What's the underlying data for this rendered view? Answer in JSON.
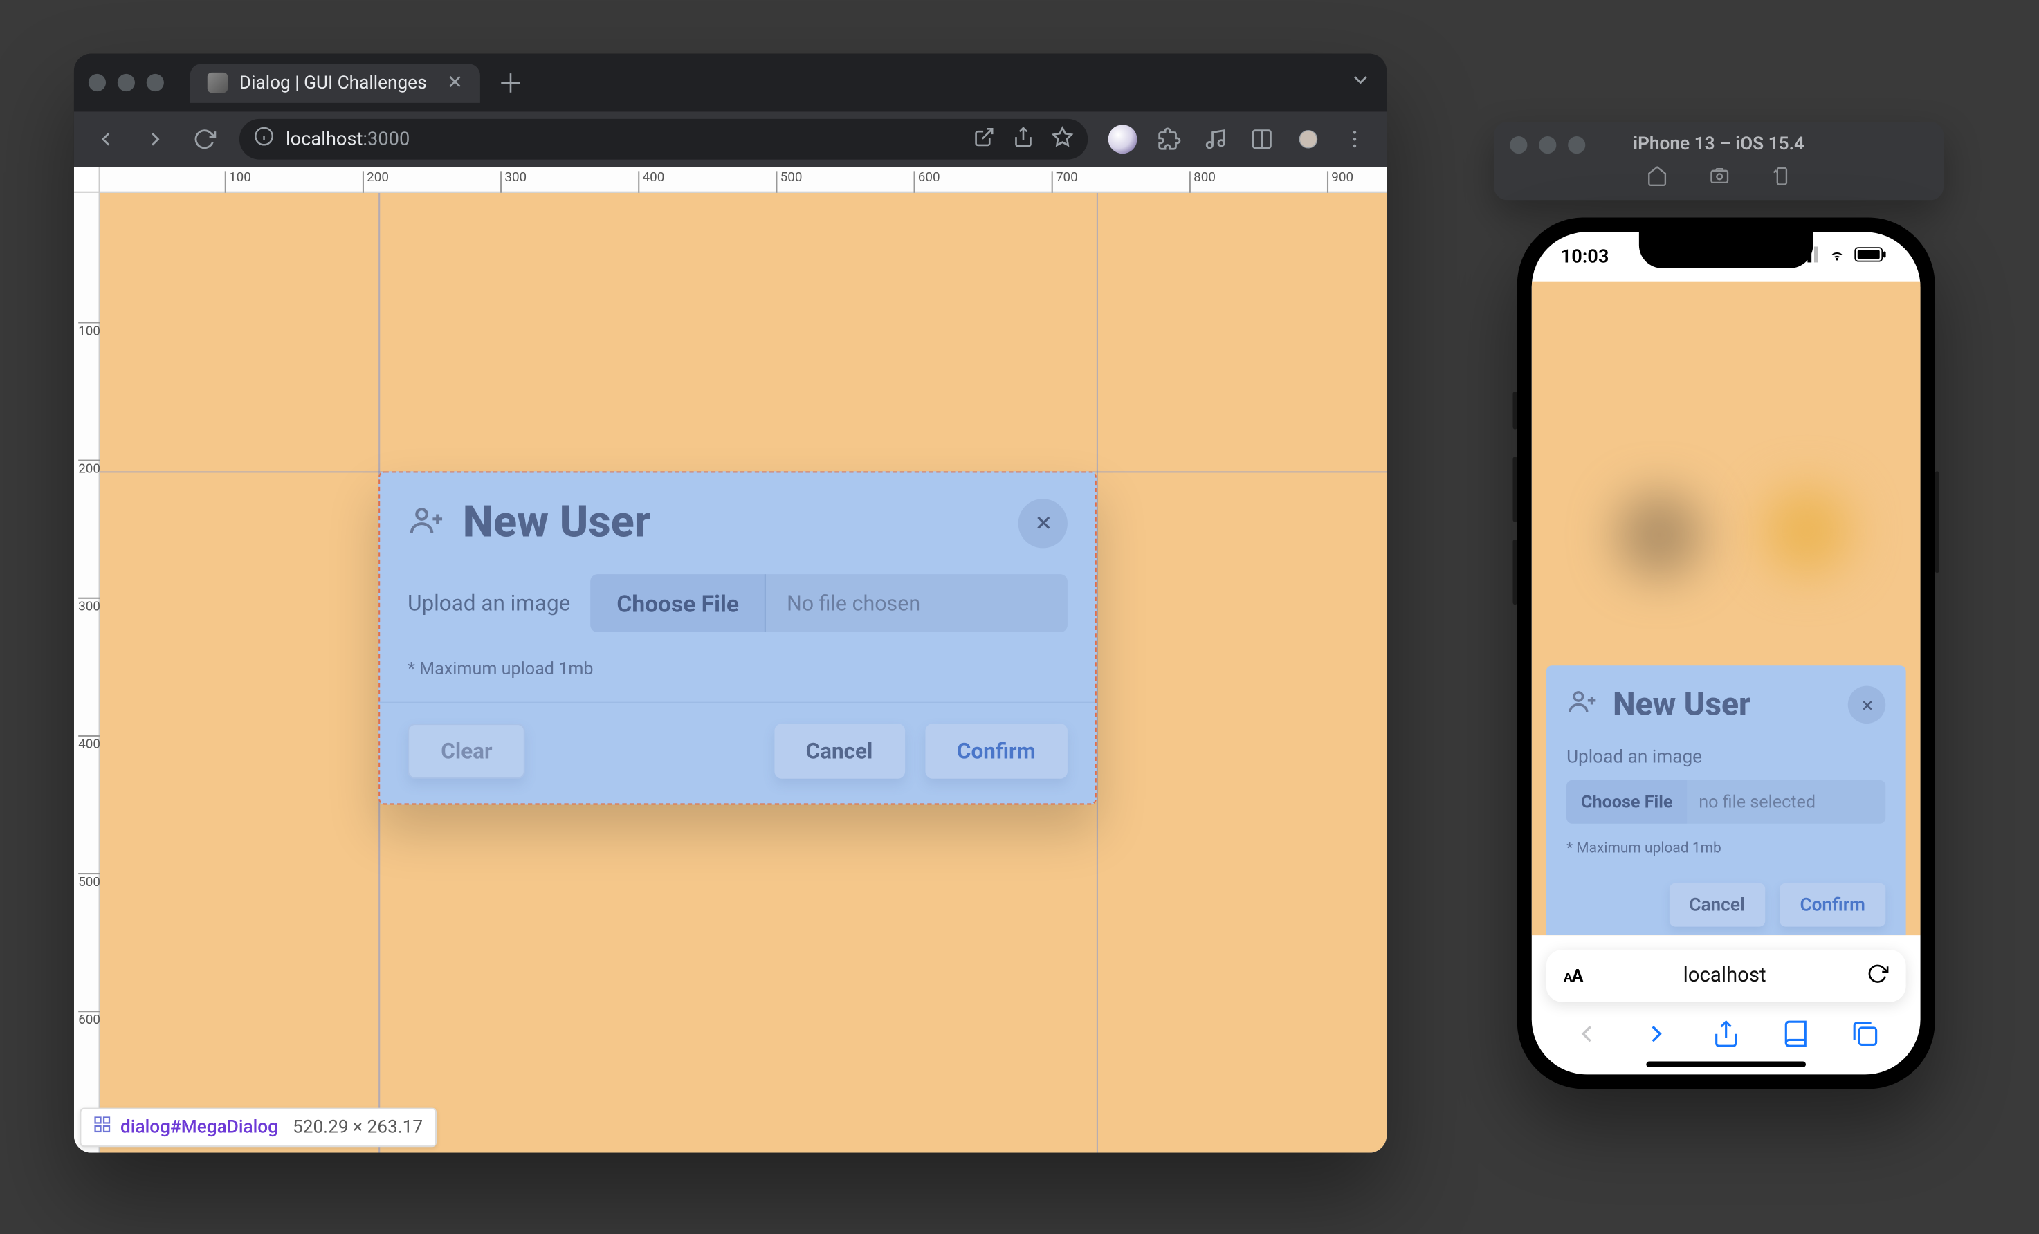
{
  "browser": {
    "tab_title": "Dialog | GUI Challenges",
    "url_host": "localhost",
    "url_port": ":3000"
  },
  "rulers": {
    "h": [
      "100",
      "200",
      "300",
      "400",
      "500",
      "600",
      "700",
      "800",
      "900"
    ],
    "v": [
      "100",
      "200",
      "300",
      "400",
      "500",
      "600"
    ]
  },
  "dialog": {
    "title": "New User",
    "upload_label": "Upload an image",
    "choose_file": "Choose File",
    "no_file": "No file chosen",
    "hint": "* Maximum upload 1mb",
    "clear": "Clear",
    "cancel": "Cancel",
    "confirm": "Confirm"
  },
  "dev_badge": {
    "selector": "dialog#MegaDialog",
    "dims": "520.29 × 263.17"
  },
  "simulator": {
    "title": "iPhone 13 – iOS 15.4"
  },
  "mobile": {
    "time": "10:03",
    "dialog": {
      "title": "New User",
      "upload_label": "Upload an image",
      "choose_file": "Choose File",
      "no_file": "no file selected",
      "hint": "* Maximum upload 1mb",
      "cancel": "Cancel",
      "confirm": "Confirm"
    },
    "safari_host": "localhost"
  }
}
